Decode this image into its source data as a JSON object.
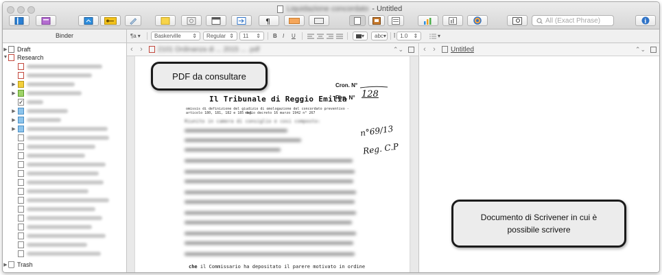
{
  "window": {
    "title_blurred": "Liquidazione concordato",
    "title_suffix": "- Untitled"
  },
  "toolbar": {
    "search_placeholder": "All (Exact Phrase)"
  },
  "formatbar": {
    "binder_label": "Binder",
    "paragraph_style": "¶a",
    "font_family": "Baskerville",
    "font_style": "Regular",
    "font_size": "11",
    "bold": "B",
    "italic": "I",
    "underline": "U",
    "highlight_label": "abc",
    "line_spacing": "1.0"
  },
  "binder": {
    "draft_label": "Draft",
    "research_label": "Research",
    "trash_label": "Trash"
  },
  "left_editor": {
    "doc_name_blurred": "2101 Ordinanza di ... 2015 ... .pdf"
  },
  "right_editor": {
    "doc_name": "Untitled"
  },
  "pdf": {
    "cron_label": "Cron. N°",
    "rep_label": "Rep. N°",
    "rep_number": "128",
    "title": "Il Tribunale di Reggio Emilia",
    "header_line1": "omissis di definizione del giudizio di omologazione del concordato preventivo - articolo 180, 181, 182 e 185 del",
    "header_line2": "regio decreto 16 marzo 1942 n° 267",
    "blur_line": "Riunito in camera di consiglio e cosi composto:",
    "hand_note1": "n°69/13",
    "hand_note2": "Reg. C.P",
    "bottom_line_bold": "che",
    "bottom_line": "il Commissario ha depositato il parere motivato in ordine"
  },
  "callouts": {
    "pdf": "PDF da consultare",
    "scrivener": "Documento di Scrivener in cui è possibile scrivere"
  }
}
